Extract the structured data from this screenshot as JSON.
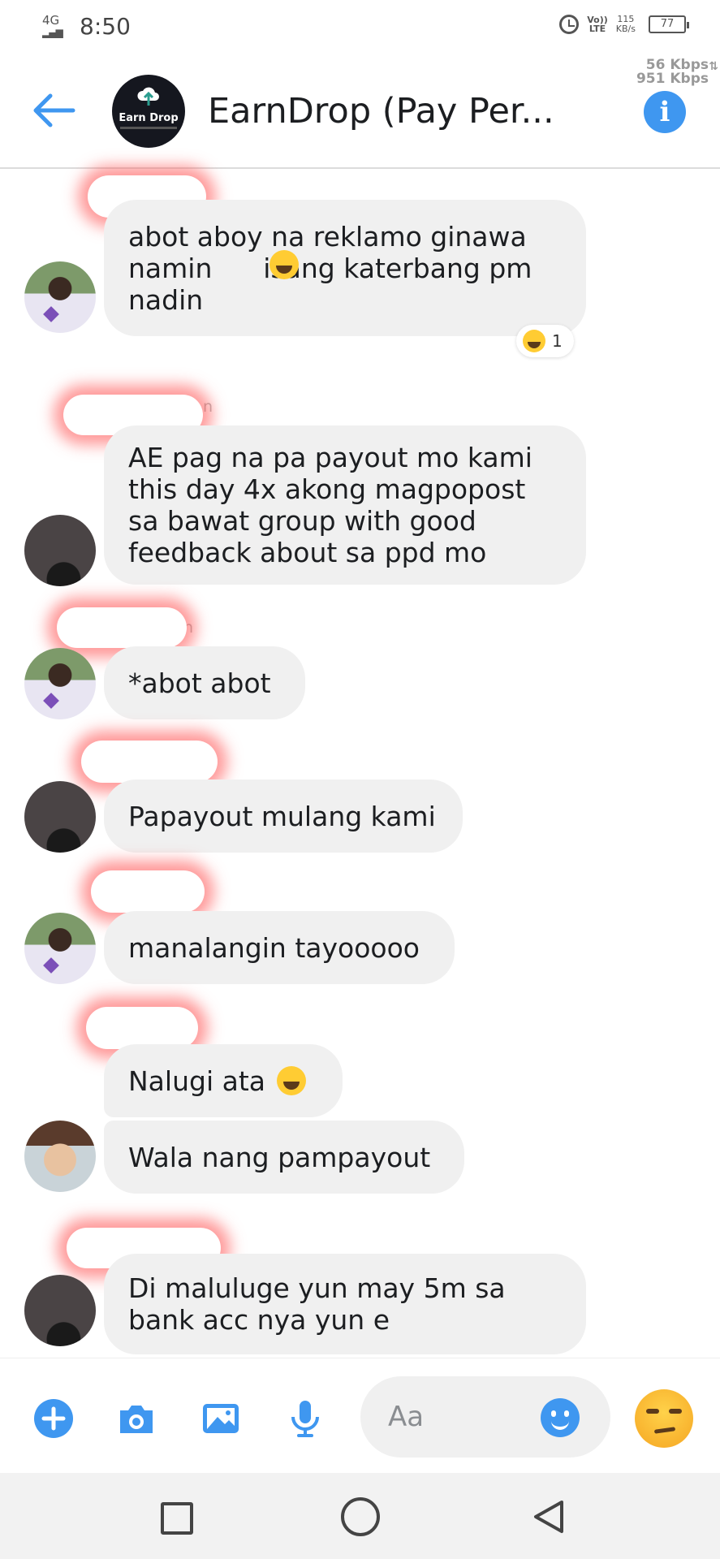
{
  "status_bar": {
    "network": "4G",
    "time": "8:50",
    "volte_top": "Vo))",
    "volte_bottom": "LTE",
    "speed_value": "115",
    "speed_unit": "KB/s",
    "battery": "77",
    "speed_up": "56 Kbps",
    "speed_down": "951 Kbps"
  },
  "header": {
    "title": "EarnDrop (Pay Per...",
    "avatar_text": "Earn Drop",
    "back_icon": "back-arrow-icon",
    "info_icon": "info-icon",
    "info_glyph": "i"
  },
  "messages": [
    {
      "text": "abot aboy na reklamo ginawa\nnamin      isang katerbang pm\nnadin",
      "reaction_count": "1"
    },
    {
      "name_tail": "n",
      "text": "AE pag na pa payout mo kami\nthis day 4x akong magpopost\nsa bawat group with good\nfeedback about sa ppd mo"
    },
    {
      "name_tail": "n",
      "text": "*abot abot"
    },
    {
      "text": "Papayout mulang kami"
    },
    {
      "text": "manalangin tayooooo"
    },
    {
      "text": "Nalugi ata"
    },
    {
      "text": "Wala nang pampayout"
    },
    {
      "text": "Di maluluge yun may 5m sa\nbank acc nya yun e"
    }
  ],
  "composer": {
    "placeholder": "Aa",
    "icons": [
      "plus-icon",
      "camera-icon",
      "gallery-icon",
      "microphone-icon",
      "emoji-icon"
    ]
  },
  "colors": {
    "accent": "#3f97f0",
    "bubble": "#f0f0f0"
  }
}
